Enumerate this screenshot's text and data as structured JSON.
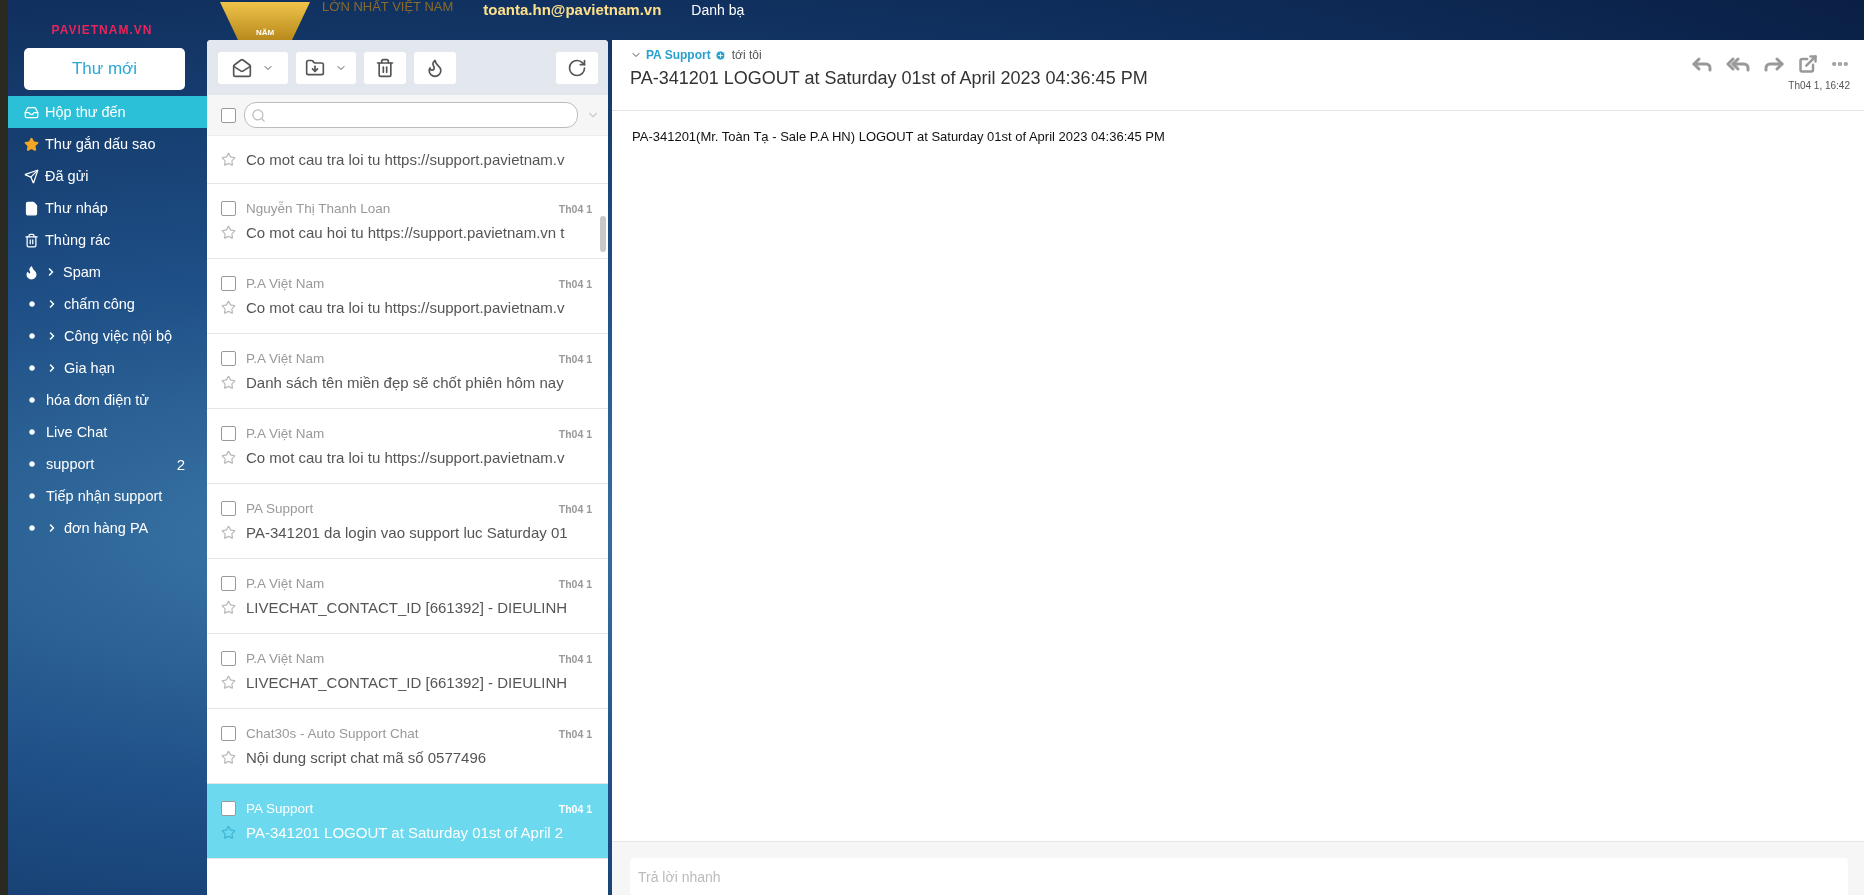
{
  "header": {
    "logo": "PAVIETNAM.VN",
    "badge": "NĂM",
    "slogan": "LỚN NHẤT VIỆT NAM",
    "account": "toanta.hn@pavietnam.vn",
    "contacts": "Danh bạ"
  },
  "sidebar": {
    "compose": "Thư mới",
    "folders": [
      {
        "label": "Hộp thư đến",
        "kind": "inbox",
        "selected": true,
        "expandable": false
      },
      {
        "label": "Thư gắn dấu sao",
        "kind": "starred",
        "selected": false,
        "expandable": false
      },
      {
        "label": "Đã gửi",
        "kind": "sent",
        "selected": false,
        "expandable": false
      },
      {
        "label": "Thư nháp",
        "kind": "draft",
        "selected": false,
        "expandable": false
      },
      {
        "label": "Thùng rác",
        "kind": "trash",
        "selected": false,
        "expandable": false
      },
      {
        "label": "Spam",
        "kind": "spam",
        "selected": false,
        "expandable": true
      },
      {
        "label": "chấm công",
        "kind": "label",
        "selected": false,
        "expandable": true
      },
      {
        "label": "Công việc nội bộ",
        "kind": "label",
        "selected": false,
        "expandable": true
      },
      {
        "label": "Gia hạn",
        "kind": "label",
        "selected": false,
        "expandable": true
      },
      {
        "label": "hóa đơn điện tử",
        "kind": "label",
        "selected": false,
        "expandable": false
      },
      {
        "label": "Live Chat",
        "kind": "label",
        "selected": false,
        "expandable": false
      },
      {
        "label": "support",
        "kind": "label",
        "selected": false,
        "expandable": false,
        "count": "2"
      },
      {
        "label": "Tiếp nhận support",
        "kind": "label",
        "selected": false,
        "expandable": false
      },
      {
        "label": "đơn hàng PA",
        "kind": "label",
        "selected": false,
        "expandable": true
      }
    ]
  },
  "list": {
    "select_all_checked": false,
    "rows": [
      {
        "subject": "Co mot cau tra loi tu https://support.pavietnam.v",
        "selected": false
      },
      {
        "sender": "Nguyễn Thị Thanh Loan",
        "date": "Th04 1",
        "subject": "Co mot cau hoi tu https://support.pavietnam.vn t",
        "selected": false
      },
      {
        "sender": "P.A Việt Nam",
        "date": "Th04 1",
        "subject": "Co mot cau tra loi tu https://support.pavietnam.v",
        "selected": false
      },
      {
        "sender": "P.A Việt Nam",
        "date": "Th04 1",
        "subject": "Danh sách tên miền đẹp sẽ chốt phiên hôm nay",
        "selected": false
      },
      {
        "sender": "P.A Việt Nam",
        "date": "Th04 1",
        "subject": "Co mot cau tra loi tu https://support.pavietnam.v",
        "selected": false
      },
      {
        "sender": "PA Support",
        "date": "Th04 1",
        "subject": "PA-341201 da login vao support luc Saturday 01",
        "selected": false
      },
      {
        "sender": "P.A Việt Nam",
        "date": "Th04 1",
        "subject": "LIVECHAT_CONTACT_ID [661392] - DIEULINH",
        "selected": false
      },
      {
        "sender": "P.A Việt Nam",
        "date": "Th04 1",
        "subject": "LIVECHAT_CONTACT_ID [661392] - DIEULINH",
        "selected": false
      },
      {
        "sender": "Chat30s - Auto Support Chat",
        "date": "Th04 1",
        "subject": "Nội dung script chat mã số 0577496",
        "selected": false
      },
      {
        "sender": "PA Support",
        "date": "Th04 1",
        "subject": "PA-341201 LOGOUT at Saturday 01st of April 2",
        "selected": true
      }
    ]
  },
  "message": {
    "from": "PA Support",
    "to": "tới tôi",
    "subject": "PA-341201 LOGOUT at Saturday 01st of April 2023 04:36:45 PM",
    "date": "Th04 1, 16:42",
    "body": "PA-341201(Mr. Toàn Tạ - Sale P.A HN) LOGOUT at Saturday 01st of April 2023 04:36:45 PM"
  },
  "quick_reply": {
    "placeholder": "Trả lời nhanh"
  }
}
